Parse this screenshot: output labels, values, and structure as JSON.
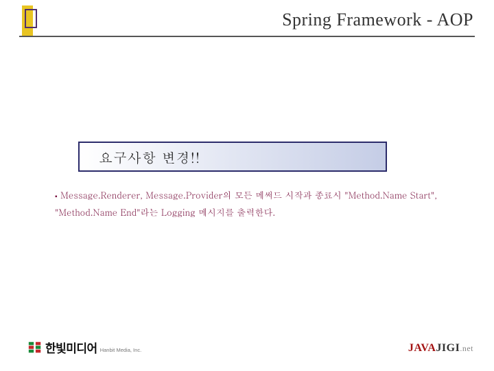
{
  "header": {
    "title": "Spring Framework - AOP"
  },
  "callout": {
    "label": "요구사항 변경!!"
  },
  "content": {
    "body": "Message.Renderer, Message.Provider의 모든 메써드 시작과 종료시 \"Method.Name Start\", \"Method.Name End\"라는 Logging 메시지를 출력한다."
  },
  "footer": {
    "left": {
      "brand_ko": "한빛미디어",
      "brand_sub": "Hanbit Media, Inc."
    },
    "right": {
      "java": "JAVA",
      "jigi": "JIGI",
      "net": ".net"
    }
  }
}
